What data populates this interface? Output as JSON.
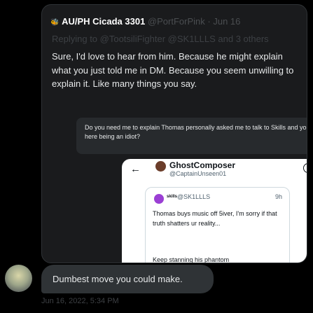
{
  "tweet": {
    "prefix": "🐝",
    "name": "AU/PH Cicada 3301",
    "handle": "@PortForPink",
    "dot": "·",
    "date": "Jun 16",
    "reply_to": "Replying to @TootsiliFighter @SK1LLLS and 3 others",
    "body": "Sure, I'd love to hear from him. Because he might explain what you just told me in DM. Because you seem unwilling to explain it. Like many things you say."
  },
  "quote": {
    "text": "Do you need me to explain Thomas personally asked me to talk to Skills and you here being an idiot?"
  },
  "embed": {
    "back_glyph": "←",
    "name": "GhostComposer",
    "handle": "@CaptainUnseen01",
    "info_glyph": "i",
    "inner": {
      "name": "skills",
      "handle": "@SK1LLLS",
      "time": "9h",
      "text": "Thomas buys music off 5iver, I'm sorry if that truth shatters ur reality...",
      "text2": "Keep stanning his phantom"
    }
  },
  "reply": {
    "text": "Dumbest move you could make.",
    "timestamp": "Jun 16, 2022, 5:34 PM"
  },
  "icons": {
    "reply_avatar": "avatar-icon"
  }
}
